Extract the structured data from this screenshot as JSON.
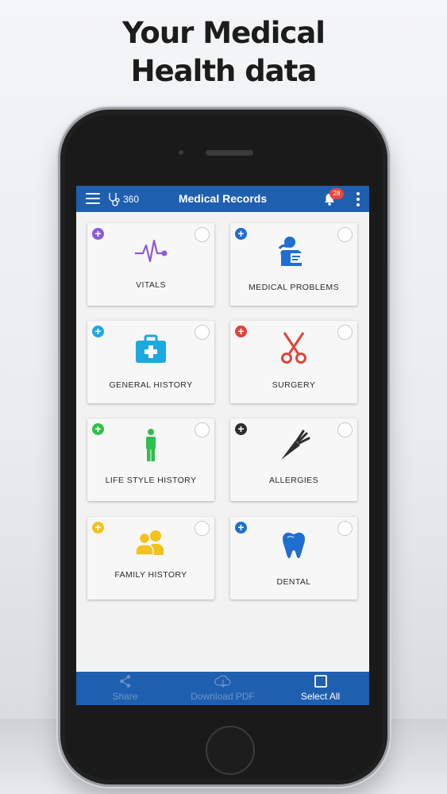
{
  "headline": {
    "line1": "Your Medical",
    "line2": "Health data"
  },
  "appbar": {
    "logo_text": "360",
    "title": "Medical Records",
    "notification_count": "28"
  },
  "cards": [
    {
      "label": "VITALS",
      "icon": "heartbeat-icon",
      "color": "#8a5cd6"
    },
    {
      "label": "MEDICAL PROBLEMS",
      "icon": "patient-icon",
      "color": "#1e6fd0"
    },
    {
      "label": "GENERAL HISTORY",
      "icon": "first-aid-kit-icon",
      "color": "#1ca8e0"
    },
    {
      "label": "SURGERY",
      "icon": "scissors-icon",
      "color": "#e0443a"
    },
    {
      "label": "LIFE STYLE HISTORY",
      "icon": "person-icon",
      "color": "#2fbf4c"
    },
    {
      "label": "ALLERGIES",
      "icon": "carrot-icon",
      "color": "#2e2e2e"
    },
    {
      "label": "FAMILY HISTORY",
      "icon": "family-icon",
      "color": "#f4c21c"
    },
    {
      "label": "DENTAL",
      "icon": "tooth-icon",
      "color": "#1e6fd0"
    }
  ],
  "bottombar": {
    "share_label": "Share",
    "download_label": "Download PDF",
    "select_all_label": "Select All"
  },
  "colors": {
    "primary": "#1f5fb0",
    "badge": "#e5483f",
    "disabled_text": "#6f93c4"
  }
}
